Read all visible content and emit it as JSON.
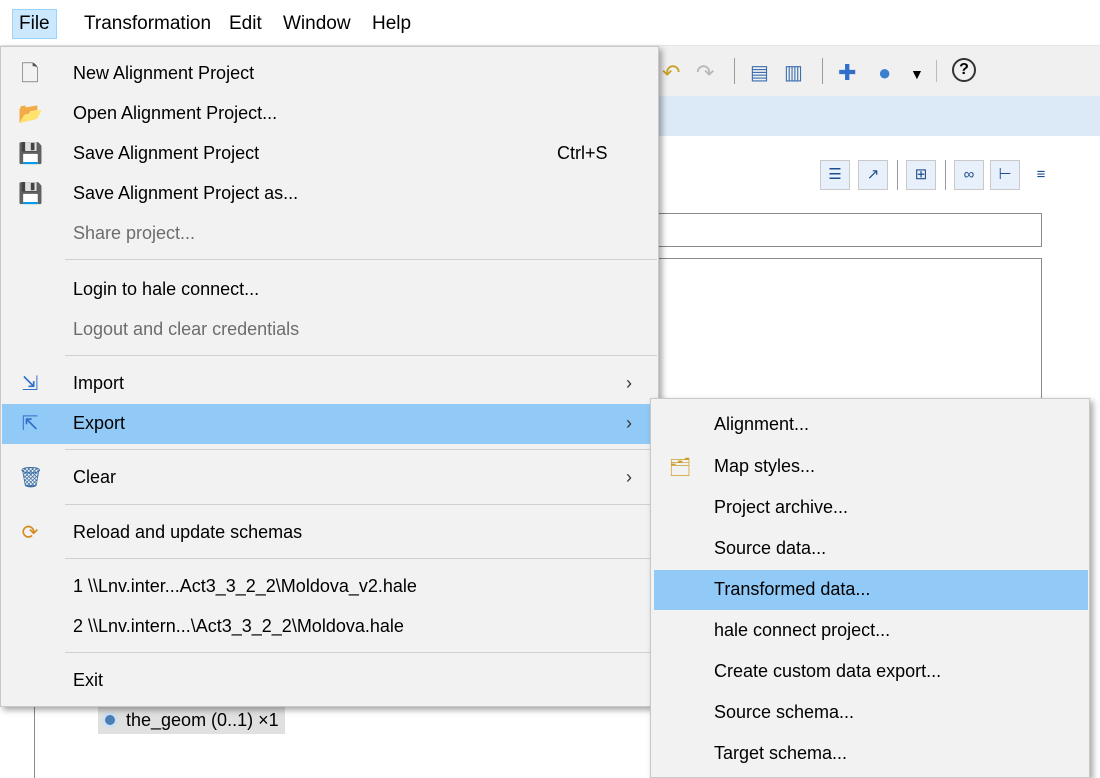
{
  "menubar": {
    "items": [
      {
        "label": "File"
      },
      {
        "label": "Transformation"
      },
      {
        "label": "Edit"
      },
      {
        "label": "Window"
      },
      {
        "label": "Help"
      }
    ]
  },
  "toolbar": {
    "icons": [
      "undo-icon",
      "redo-icon",
      "source-schema-icon",
      "target-schema-icon",
      "connect-icon",
      "globe-icon",
      "dropdown-arrow-icon",
      "help-icon"
    ]
  },
  "panel": {
    "tree_node": "the_geom (0..1) ×1"
  },
  "file_menu": {
    "items": [
      {
        "label": "New Alignment Project",
        "icon": "new-project-icon"
      },
      {
        "label": "Open Alignment Project...",
        "icon": "folder-open-icon"
      },
      {
        "label": "Save Alignment Project",
        "accel": "Ctrl+S",
        "icon": "save-icon"
      },
      {
        "label": "Save Alignment Project as...",
        "icon": "save-as-icon"
      },
      {
        "label": "Share project...",
        "disabled": true
      },
      {
        "label": "Login to hale connect..."
      },
      {
        "label": "Logout and clear credentials",
        "disabled": true
      },
      {
        "label": "Import",
        "icon": "import-icon",
        "submenu": true
      },
      {
        "label": "Export",
        "icon": "export-icon",
        "submenu": true,
        "highlighted": true
      },
      {
        "label": "Clear",
        "icon": "trash-icon",
        "submenu": true
      },
      {
        "label": "Reload and update schemas",
        "icon": "reload-icon"
      },
      {
        "label": "1 \\\\Lnv.inter...Act3_3_2_2\\Moldova_v2.hale"
      },
      {
        "label": "2 \\\\Lnv.intern...\\Act3_3_2_2\\Moldova.hale"
      },
      {
        "label": "Exit"
      }
    ]
  },
  "export_submenu": {
    "items": [
      {
        "label": "Alignment..."
      },
      {
        "label": "Map styles...",
        "icon": "map-styles-icon"
      },
      {
        "label": "Project archive..."
      },
      {
        "label": "Source data..."
      },
      {
        "label": "Transformed data...",
        "highlighted": true
      },
      {
        "label": "hale connect project..."
      },
      {
        "label": "Create custom data export..."
      },
      {
        "label": "Source schema..."
      },
      {
        "label": "Target schema..."
      }
    ]
  },
  "colors": {
    "menu_bg": "#f2f2f2",
    "highlight": "#91c9f7",
    "menubar_active": "#cce8ff"
  }
}
